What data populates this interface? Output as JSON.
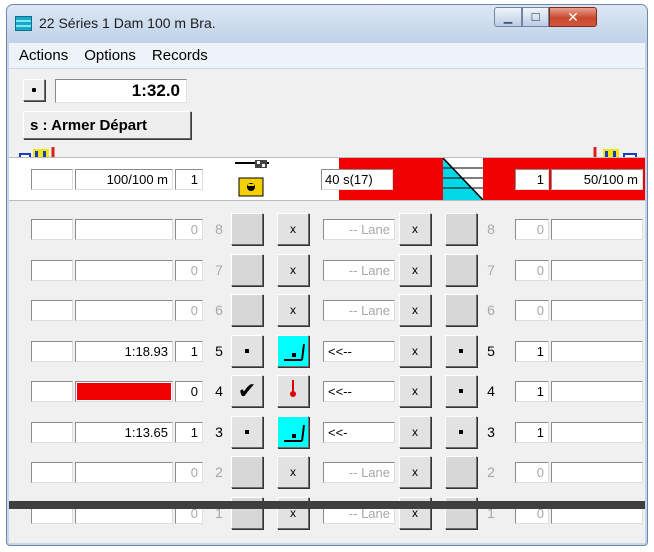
{
  "window": {
    "title": "22 Séries 1  Dam 100 m Bra."
  },
  "menu": [
    "Actions",
    "Options",
    "Records"
  ],
  "controls": {
    "time": "1:32.0",
    "arm_label": "s : Armer Départ"
  },
  "header": {
    "left_distance": "100/100  m",
    "left_count": "1",
    "timer": "40 s(17)",
    "right_count": "1",
    "right_distance": "50/100  m"
  },
  "rows": [
    {
      "lane": "8",
      "active": false,
      "left_time": "",
      "left_place": "0",
      "lane_label": "-- Lane",
      "mid": "x",
      "right_place": "0",
      "arrow_cyan": false
    },
    {
      "lane": "7",
      "active": false,
      "left_time": "",
      "left_place": "0",
      "lane_label": "-- Lane",
      "mid": "x",
      "right_place": "0",
      "arrow_cyan": false
    },
    {
      "lane": "6",
      "active": false,
      "left_time": "",
      "left_place": "0",
      "lane_label": "-- Lane",
      "mid": "x",
      "right_place": "0",
      "arrow_cyan": false
    },
    {
      "lane": "5",
      "active": true,
      "left_time": "1:18.93",
      "left_place": "1",
      "lane_label": "<<--",
      "mid": "x",
      "right_place": "1",
      "arrow_cyan": true
    },
    {
      "lane": "4",
      "active": true,
      "left_time": "",
      "left_place": "0",
      "lane_label": "<<--",
      "mid": "x",
      "right_place": "1",
      "arrow_cyan": false,
      "red_bar": true,
      "check": "✔"
    },
    {
      "lane": "3",
      "active": true,
      "left_time": "1:13.65",
      "left_place": "1",
      "lane_label": "<<-",
      "mid": "x",
      "right_place": "1",
      "arrow_cyan": true
    },
    {
      "lane": "2",
      "active": false,
      "left_time": "",
      "left_place": "0",
      "lane_label": "-- Lane",
      "mid": "x",
      "right_place": "0",
      "arrow_cyan": false
    },
    {
      "lane": "1",
      "active": false,
      "left_time": "",
      "left_place": "0",
      "lane_label": "-- Lane",
      "mid": "x",
      "right_place": "0",
      "arrow_cyan": false
    }
  ],
  "colors": {
    "red": "#f00000",
    "cyan": "#00ffff",
    "window_frame": "#c6d6ea"
  },
  "icons": [
    "app-icon",
    "pool-left-icon",
    "pool-right-icon",
    "starter-icon",
    "lane-rope-icon"
  ]
}
